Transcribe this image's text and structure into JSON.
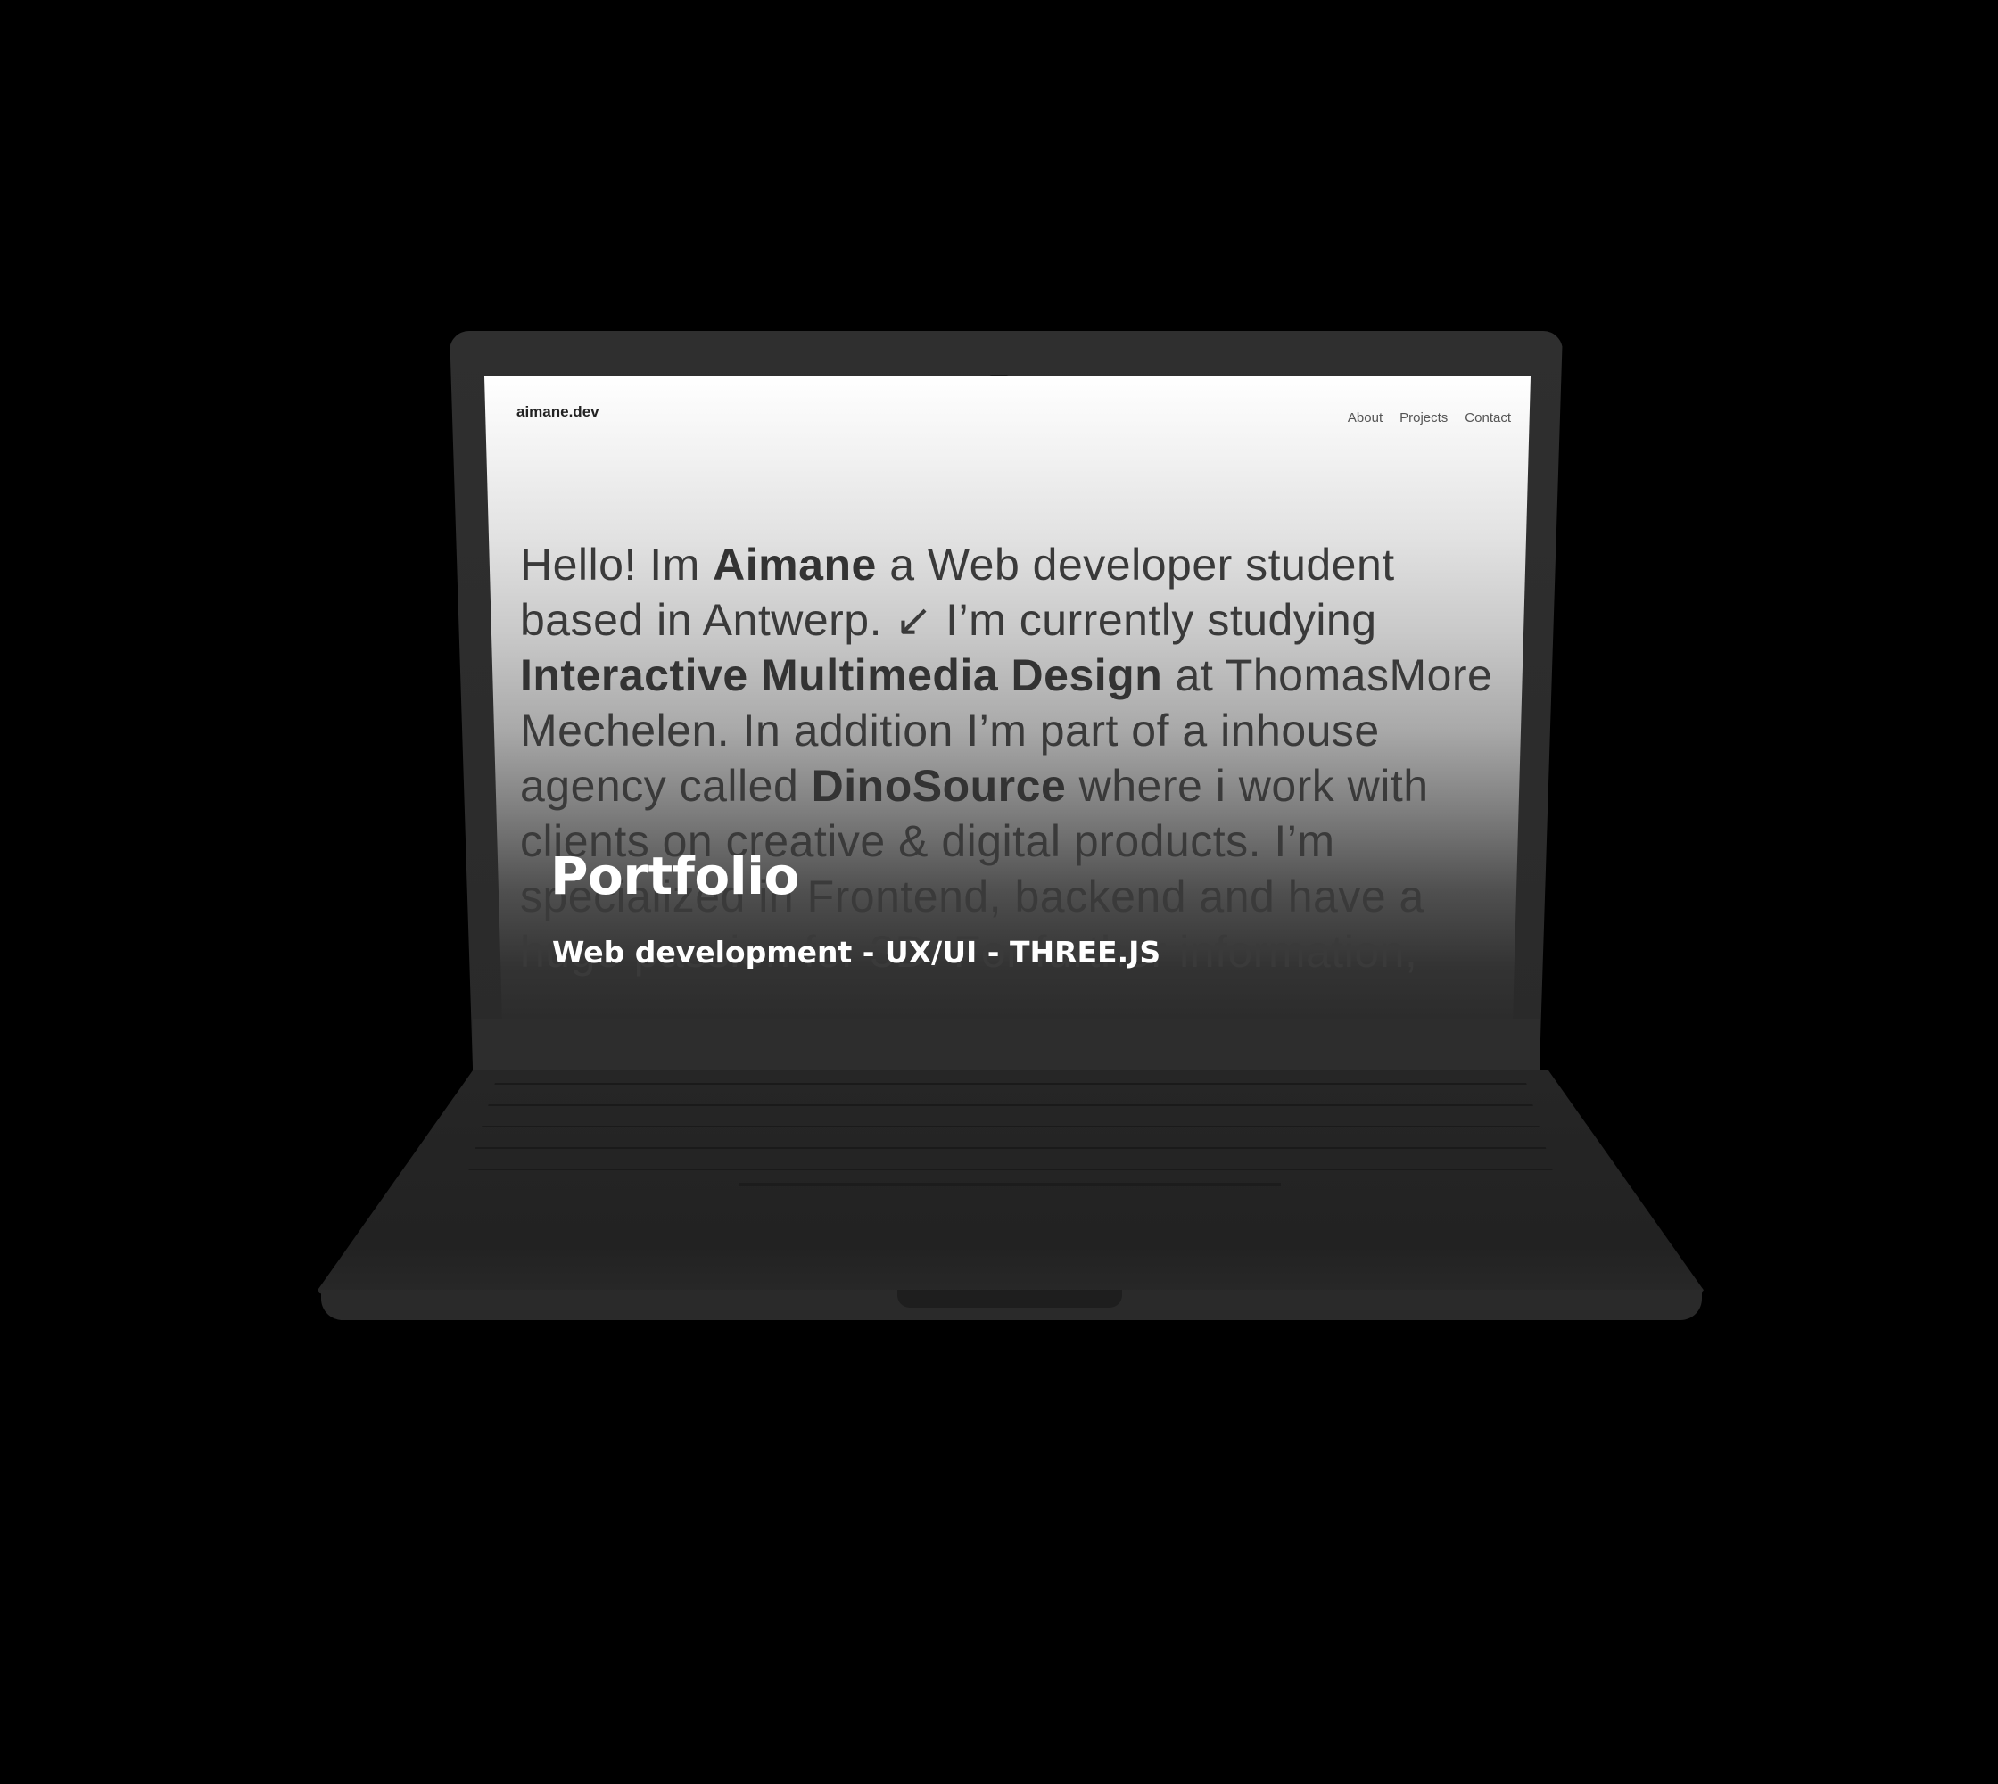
{
  "site": {
    "logo": "aimane.dev",
    "nav": [
      "About",
      "Projects",
      "Contact"
    ]
  },
  "intro": {
    "t1": "Hello! Im ",
    "b1": "Aimane",
    "t2": " a Web developer student based in Antwerp. ↙ I’m currently studying ",
    "b2": "Interactive Multimedia Design",
    "t3": " at ThomasMore Mechelen. In addition I’m part of a inhouse agency called ",
    "b3": "DinoSource",
    "t4": " where i work with clients on creative & digital products. I’m specialized in Frontend, backend and have a huge passion for 3D. For further information, "
  },
  "hero": {
    "title": "Portfolio",
    "subtitle": "Web development - UX/UI - THREE.JS"
  },
  "colors": {
    "background": "#000000",
    "device": "#2a2a2a",
    "hero_text": "#ffffff"
  }
}
